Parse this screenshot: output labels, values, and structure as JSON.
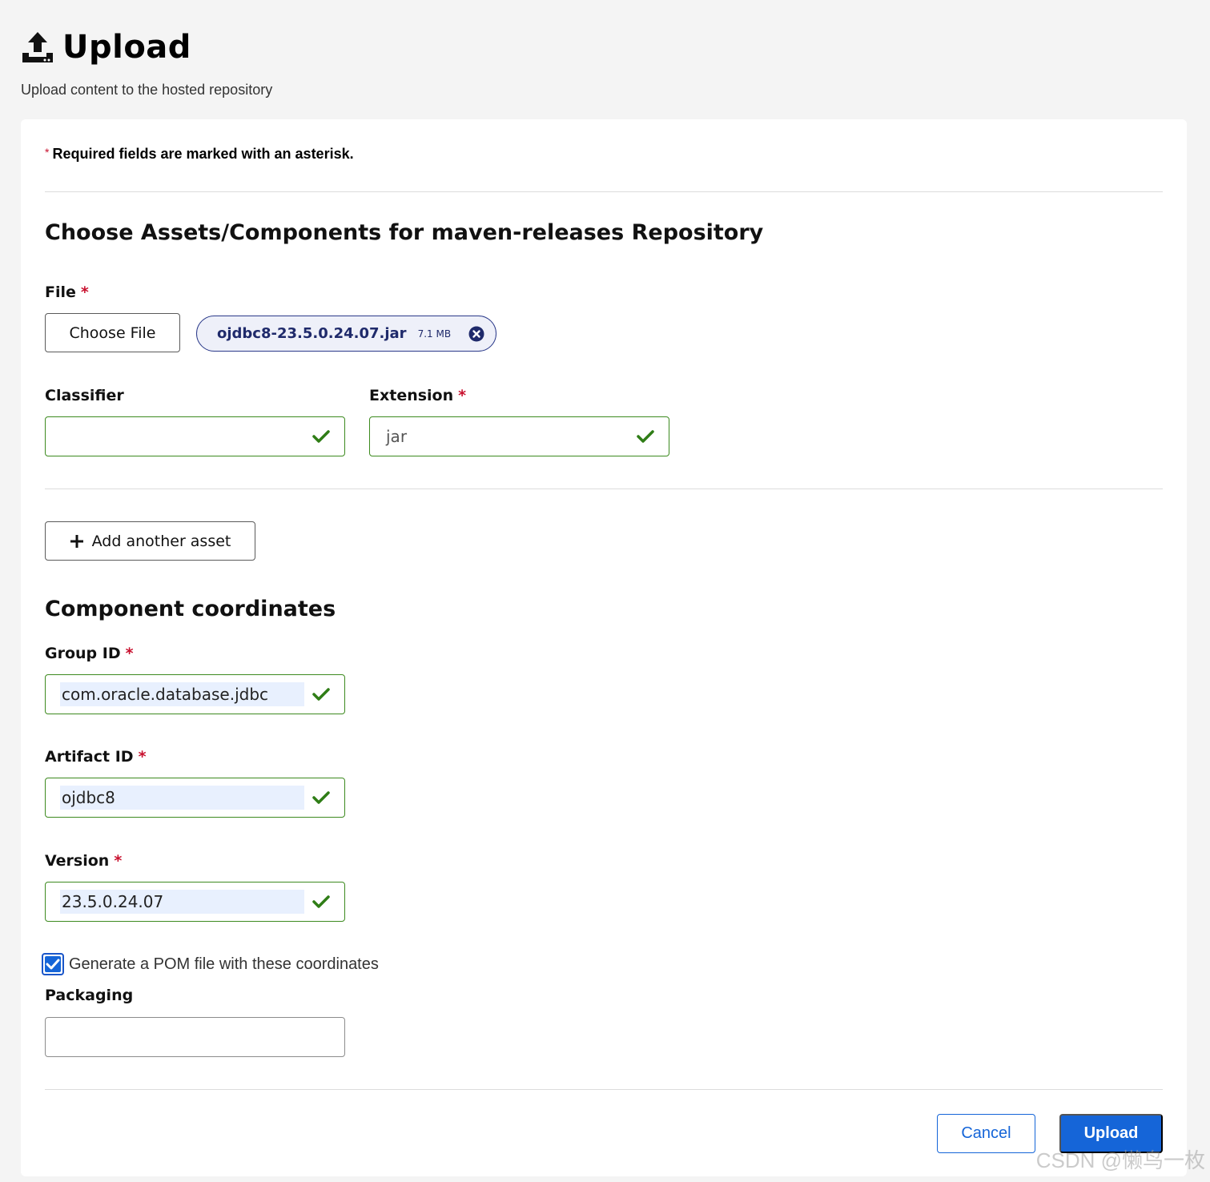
{
  "header": {
    "title": "Upload",
    "subtitle": "Upload content to the hosted repository"
  },
  "form": {
    "required_note": "Required fields are marked with an asterisk.",
    "required_mark": "*",
    "assets_heading": "Choose Assets/Components for maven-releases Repository",
    "file": {
      "label": "File",
      "choose_button": "Choose File",
      "selected_name": "ojdbc8-23.5.0.24.07.jar",
      "selected_size": "7.1 MB"
    },
    "classifier": {
      "label": "Classifier",
      "value": ""
    },
    "extension": {
      "label": "Extension",
      "value": "jar"
    },
    "add_asset_button": "Add another asset",
    "coordinates_heading": "Component coordinates",
    "group_id": {
      "label": "Group ID",
      "value": "com.oracle.database.jdbc"
    },
    "artifact_id": {
      "label": "Artifact ID",
      "value": "ojdbc8"
    },
    "version": {
      "label": "Version",
      "value": "23.5.0.24.07"
    },
    "generate_pom": {
      "label": "Generate a POM file with these coordinates",
      "checked": true
    },
    "packaging": {
      "label": "Packaging",
      "value": ""
    },
    "cancel_button": "Cancel",
    "upload_button": "Upload"
  },
  "watermark": "CSDN @懒鸟一枚",
  "colors": {
    "valid_border": "#3d8a1f",
    "primary": "#1565d8",
    "required": "#c8102e",
    "chip_border": "#2b3a8a"
  }
}
